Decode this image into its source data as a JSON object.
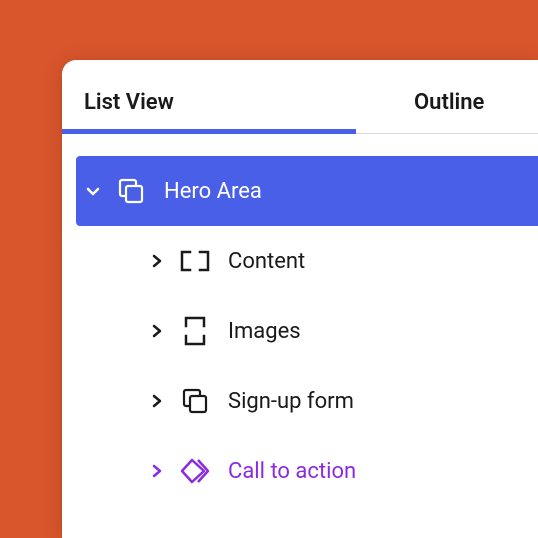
{
  "tabs": {
    "list_view": "List View",
    "outline": "Outline",
    "active": "list_view"
  },
  "tree": {
    "hero_area": {
      "label": "Hero Area",
      "expanded": true,
      "selected": true
    },
    "content": {
      "label": "Content",
      "expanded": false
    },
    "images": {
      "label": "Images",
      "expanded": false
    },
    "signup_form": {
      "label": "Sign-up form",
      "expanded": false
    },
    "call_to_action": {
      "label": "Call to action",
      "expanded": false,
      "accent": true
    }
  },
  "colors": {
    "background": "#d9552c",
    "primary": "#4a5fe8",
    "accent": "#8a2be2"
  }
}
